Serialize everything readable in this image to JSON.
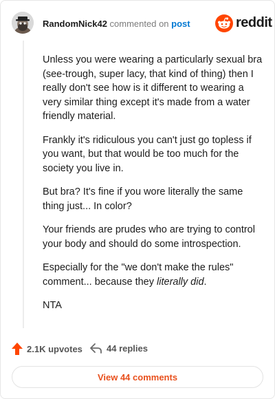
{
  "header": {
    "username": "RandomNick42",
    "action_text": "commented on",
    "post_link": "post",
    "brand": "reddit"
  },
  "comment": {
    "paragraphs": [
      "Unless you were wearing a particularly sexual bra (see-trough, super lacy, that kind of thing) then I really don't see how is it different to wearing a very similar thing except it's made from a water friendly material.",
      "Frankly it's ridiculous you can't just go topless if you want, but that would be too much for the society you live in.",
      "But bra? It's fine if you wore literally the same thing just... In color?",
      "Your friends are prudes who are trying to control your body and should do some introspection."
    ],
    "p5_text": "Especially for the \"we don't make the rules\" comment... because they ",
    "p5_emphasis": "literally did",
    "p5_end": ".",
    "signoff": "NTA"
  },
  "footer": {
    "upvotes": "2.1K upvotes",
    "replies": "44 replies",
    "view_comments": "View 44 comments"
  },
  "colors": {
    "reddit_orange": "#ff4500",
    "link_blue": "#0079d3",
    "upvote_icon": "#ff4500"
  },
  "icons": {
    "avatar": "avatar-snoo-bearded-hat",
    "brand_logo": "reddit-snoo-icon",
    "upvote": "upvote-arrow-icon",
    "reply": "reply-arrow-icon"
  }
}
